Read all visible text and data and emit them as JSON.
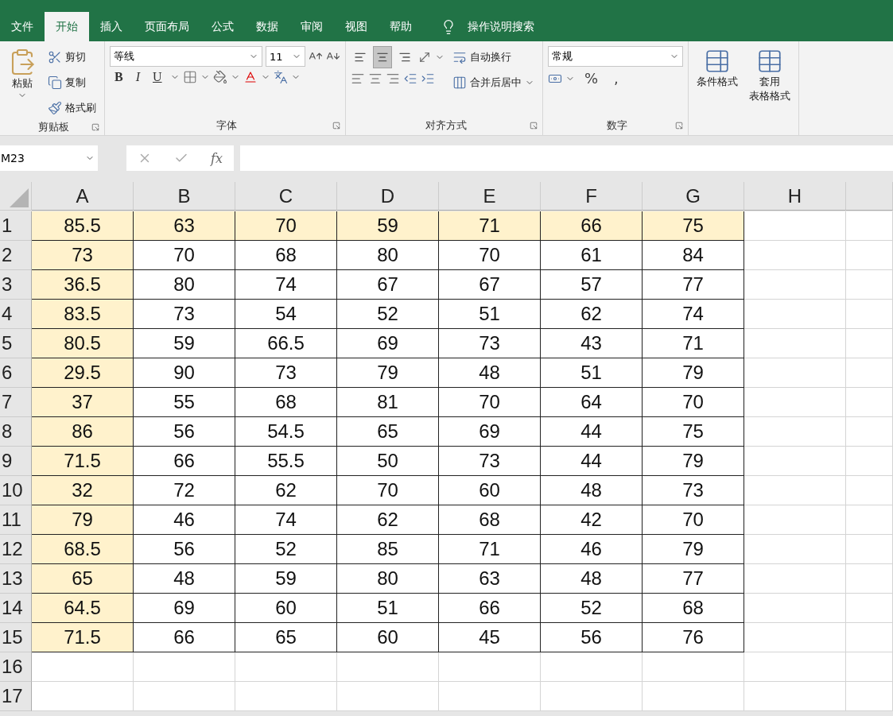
{
  "tabs": [
    {
      "label": "文件",
      "selected": false
    },
    {
      "label": "开始",
      "selected": true
    },
    {
      "label": "插入",
      "selected": false
    },
    {
      "label": "页面布局",
      "selected": false
    },
    {
      "label": "公式",
      "selected": false
    },
    {
      "label": "数据",
      "selected": false
    },
    {
      "label": "审阅",
      "selected": false
    },
    {
      "label": "视图",
      "selected": false
    },
    {
      "label": "帮助",
      "selected": false
    }
  ],
  "search": {
    "placeholder": "操作说明搜索"
  },
  "ribbon": [
    {
      "kind": "clipboard",
      "label": "剪贴板",
      "paste": "粘贴",
      "items": [
        "剪切",
        "复制",
        "格式刷"
      ]
    },
    {
      "kind": "font",
      "label": "字体",
      "font": "等线",
      "size": "11",
      "styles": [
        "B",
        "I",
        "U"
      ]
    },
    {
      "kind": "alignment",
      "label": "对齐方式",
      "vertical": [
        {
          "selected": false
        },
        {
          "selected": true
        },
        {
          "selected": false
        }
      ],
      "wrap": "自动换行",
      "merge": "合并后居中"
    },
    {
      "kind": "number",
      "label": "数字",
      "format": "常规",
      "symbols": [
        "%",
        ","
      ]
    },
    {
      "kind": "styles",
      "buttons": [
        [
          "条件格式"
        ],
        [
          "套用",
          "表格格式"
        ]
      ]
    }
  ],
  "name_box": "M23",
  "formula_label": "fx",
  "columns": [
    {
      "label": "A",
      "highlighted": true
    },
    {
      "label": "B",
      "highlighted": false
    },
    {
      "label": "C",
      "highlighted": false
    },
    {
      "label": "D",
      "highlighted": false
    },
    {
      "label": "E",
      "highlighted": false
    },
    {
      "label": "F",
      "highlighted": false
    },
    {
      "label": "G",
      "highlighted": false
    },
    {
      "label": "H"
    }
  ],
  "rows": [
    {
      "header": "1",
      "highlighted": true,
      "cells": [
        "85.5",
        "63",
        "70",
        "59",
        "71",
        "66",
        "75"
      ]
    },
    {
      "header": "2",
      "highlighted": false,
      "cells": [
        "73",
        "70",
        "68",
        "80",
        "70",
        "61",
        "84"
      ]
    },
    {
      "header": "3",
      "highlighted": false,
      "cells": [
        "36.5",
        "80",
        "74",
        "67",
        "67",
        "57",
        "77"
      ]
    },
    {
      "header": "4",
      "highlighted": false,
      "cells": [
        "83.5",
        "73",
        "54",
        "52",
        "51",
        "62",
        "74"
      ]
    },
    {
      "header": "5",
      "highlighted": false,
      "cells": [
        "80.5",
        "59",
        "66.5",
        "69",
        "73",
        "43",
        "71"
      ]
    },
    {
      "header": "6",
      "highlighted": false,
      "cells": [
        "29.5",
        "90",
        "73",
        "79",
        "48",
        "51",
        "79"
      ]
    },
    {
      "header": "7",
      "highlighted": false,
      "cells": [
        "37",
        "55",
        "68",
        "81",
        "70",
        "64",
        "70"
      ]
    },
    {
      "header": "8",
      "highlighted": false,
      "cells": [
        "86",
        "56",
        "54.5",
        "65",
        "69",
        "44",
        "75"
      ]
    },
    {
      "header": "9",
      "highlighted": false,
      "cells": [
        "71.5",
        "66",
        "55.5",
        "50",
        "73",
        "44",
        "79"
      ]
    },
    {
      "header": "10",
      "highlighted": false,
      "cells": [
        "32",
        "72",
        "62",
        "70",
        "60",
        "48",
        "73"
      ]
    },
    {
      "header": "11",
      "highlighted": false,
      "cells": [
        "79",
        "46",
        "74",
        "62",
        "68",
        "42",
        "70"
      ]
    },
    {
      "header": "12",
      "highlighted": false,
      "cells": [
        "68.5",
        "56",
        "52",
        "85",
        "71",
        "46",
        "79"
      ]
    },
    {
      "header": "13",
      "highlighted": false,
      "cells": [
        "65",
        "48",
        "59",
        "80",
        "63",
        "48",
        "77"
      ]
    },
    {
      "header": "14",
      "highlighted": false,
      "cells": [
        "64.5",
        "69",
        "60",
        "51",
        "66",
        "52",
        "68"
      ]
    },
    {
      "header": "15",
      "highlighted": false,
      "cells": [
        "71.5",
        "66",
        "65",
        "60",
        "45",
        "56",
        "76"
      ]
    },
    {
      "header": "16"
    },
    {
      "header": "17"
    }
  ]
}
